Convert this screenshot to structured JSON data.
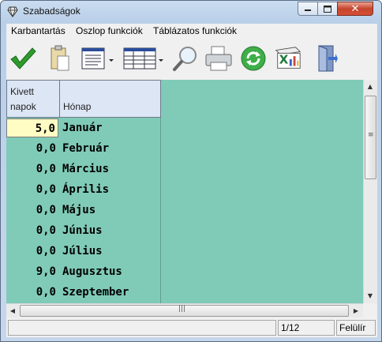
{
  "window": {
    "title": "Szabadságok"
  },
  "menu": [
    "Karbantartás",
    "Oszlop funkciók",
    "Táblázatos funkciók"
  ],
  "toolbar": [
    {
      "icon": "checkmark-icon",
      "name": "ok-button"
    },
    {
      "icon": "clipboard-icon",
      "name": "paste-button"
    },
    {
      "icon": "form-view-icon",
      "name": "form-view-button"
    },
    {
      "icon": "table-view-icon",
      "name": "table-view-button"
    },
    {
      "icon": "magnifier-icon",
      "name": "search-button"
    },
    {
      "icon": "printer-icon",
      "name": "print-button"
    },
    {
      "icon": "refresh-icon",
      "name": "refresh-button"
    },
    {
      "icon": "excel-export-icon",
      "name": "excel-export-button"
    },
    {
      "icon": "exit-door-icon",
      "name": "exit-button"
    }
  ],
  "table": {
    "columns": [
      {
        "label_line1": "Kivett",
        "label_line2": "napok"
      },
      {
        "label_line1": "",
        "label_line2": "Hónap"
      }
    ],
    "rows": [
      {
        "days": "5,0",
        "month": "Január"
      },
      {
        "days": "0,0",
        "month": "Február"
      },
      {
        "days": "0,0",
        "month": "Március"
      },
      {
        "days": "0,0",
        "month": "Április"
      },
      {
        "days": "0,0",
        "month": "Május"
      },
      {
        "days": "0,0",
        "month": "Június"
      },
      {
        "days": "0,0",
        "month": "Július"
      },
      {
        "days": "9,0",
        "month": "Augusztus"
      },
      {
        "days": "0,0",
        "month": "Szeptember"
      }
    ],
    "selected_row": 0
  },
  "status": {
    "left": "",
    "position": "1/12",
    "mode": "Felülír"
  },
  "colors": {
    "grid_bg": "#80cbb7",
    "header_bg": "#dce6f5",
    "selected_cell": "#fffcc4"
  }
}
